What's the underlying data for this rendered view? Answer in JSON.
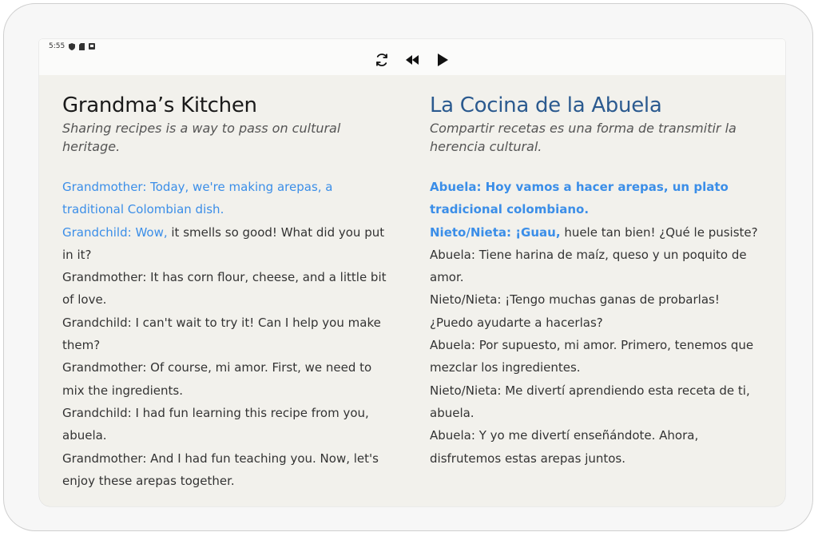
{
  "status_bar": {
    "time": "5:55",
    "icons": [
      "shield-icon",
      "sim-card-icon",
      "notification-icon"
    ]
  },
  "controls": {
    "icons": [
      "refresh-icon",
      "rewind-icon",
      "play-icon"
    ]
  },
  "english": {
    "title": "Grandma’s Kitchen",
    "subtitle": "Sharing recipes is a way to pass on cultural heritage.",
    "lines": [
      {
        "highlight": "Grandmother: Today, we're making arepas, a traditional Colombian dish.",
        "rest": ""
      },
      {
        "highlight": "Grandchild: Wow,",
        "rest": " it smells so good! What did you put in it?"
      },
      {
        "highlight": "",
        "rest": "Grandmother: It has corn flour, cheese, and a little bit of love."
      },
      {
        "highlight": "",
        "rest": "Grandchild: I can't wait to try it! Can I help you make them?"
      },
      {
        "highlight": "",
        "rest": "Grandmother: Of course, mi amor. First, we need to mix the ingredients."
      },
      {
        "highlight": "",
        "rest": "Grandchild: I had fun learning this recipe from you, abuela."
      },
      {
        "highlight": "",
        "rest": "Grandmother: And I had fun teaching you. Now, let's enjoy these arepas together."
      }
    ]
  },
  "spanish": {
    "title": "La Cocina de la Abuela",
    "subtitle": "Compartir recetas es una forma de transmitir la herencia cultural.",
    "lines": [
      {
        "highlight": "Abuela: Hoy vamos a hacer arepas, un plato tradicional colombiano.",
        "rest": ""
      },
      {
        "highlight": "Nieto/Nieta: ¡Guau,",
        "rest": " huele tan bien! ¿Qué le pusiste?"
      },
      {
        "highlight": "",
        "rest": "Abuela: Tiene harina de maíz, queso y un poquito de amor."
      },
      {
        "highlight": "",
        "rest": "Nieto/Nieta: ¡Tengo muchas ganas de probarlas! ¿Puedo ayudarte a hacerlas?"
      },
      {
        "highlight": "",
        "rest": "Abuela: Por supuesto, mi amor. Primero, tenemos que mezclar los ingredientes."
      },
      {
        "highlight": "",
        "rest": "Nieto/Nieta: Me divertí aprendiendo esta receta de ti, abuela."
      },
      {
        "highlight": "",
        "rest": "Abuela: Y yo me divertí enseñándote. Ahora, disfrutemos estas arepas juntos."
      }
    ]
  },
  "colors": {
    "highlight": "#3b8ee8",
    "spanish_title": "#2b5a8f",
    "background": "#f2f1ec"
  }
}
